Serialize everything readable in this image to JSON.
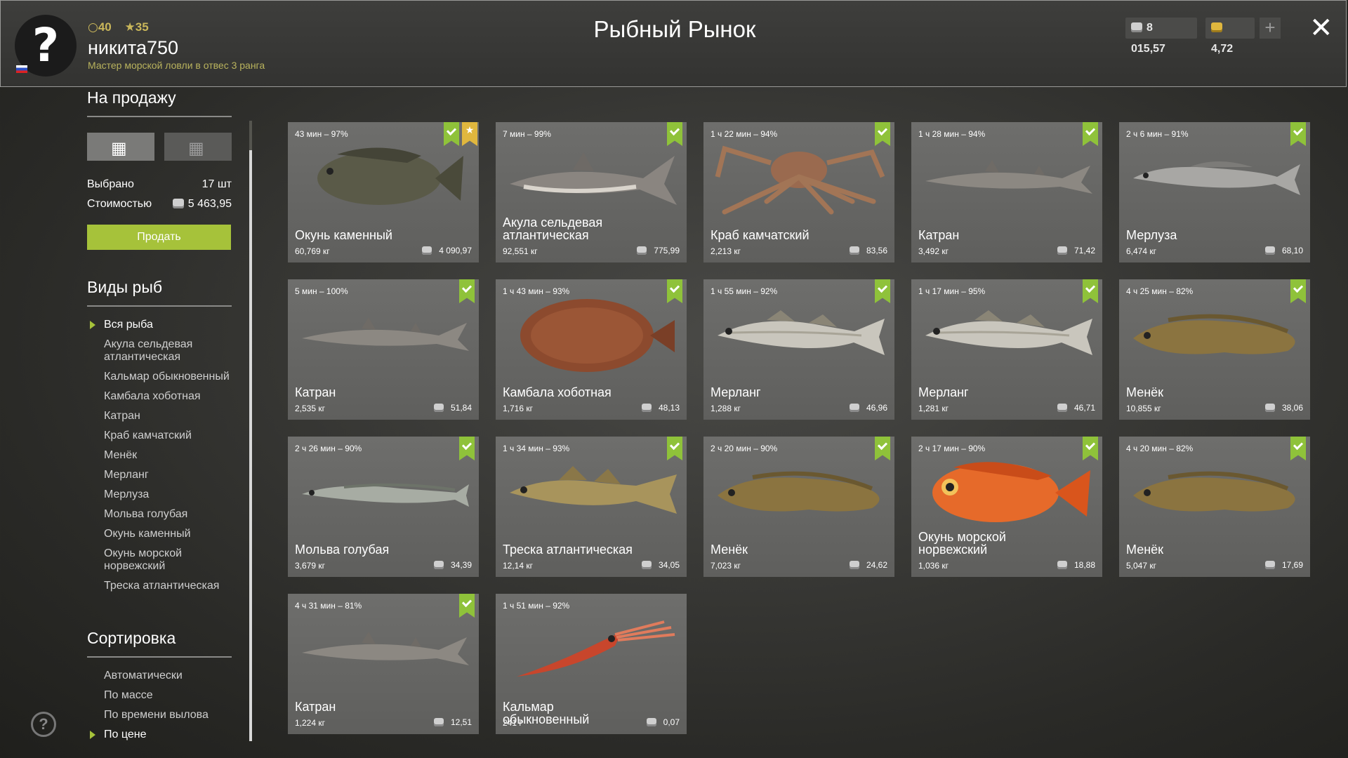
{
  "header": {
    "level": "40",
    "stars": "35",
    "username": "никита750",
    "rank": "Мастер морской ловли в отвес 3 ранга",
    "title": "Рыбный Рынок",
    "silver": "8 015,57",
    "gold": "4,72",
    "plus": "+",
    "close": "✕",
    "avatar": "?"
  },
  "sidebar": {
    "for_sale_title": "На продажу",
    "selected_label": "Выбрано",
    "selected_value": "17 шт",
    "cost_label": "Стоимостью",
    "cost_value": "5 463,95",
    "sell_button": "Продать",
    "fish_types_title": "Виды рыб",
    "fish_types": [
      "Вся рыба",
      "Акула сельдевая атлантическая",
      "Кальмар обыкновенный",
      "Камбала хоботная",
      "Катран",
      "Краб камчатский",
      "Менёк",
      "Мерланг",
      "Мерлуза",
      "Мольва голубая",
      "Окунь каменный",
      "Окунь морской норвежский",
      "Треска атлантическая"
    ],
    "sort_title": "Сортировка",
    "sort_options": [
      "Автоматически",
      "По массе",
      "По времени вылова",
      "По цене"
    ]
  },
  "colors": {
    "accent": "#a6c23a",
    "badge": "#8fc23a",
    "gold": "#e0b73e"
  },
  "cards": [
    {
      "time": "43 мин – 97%",
      "name": "Окунь каменный",
      "weight": "60,769 кг",
      "price": "4 090,97",
      "icon": "grouper"
    },
    {
      "time": "7 мин – 99%",
      "name": "Акула сельдевая атлантическая",
      "weight": "92,551 кг",
      "price": "775,99",
      "icon": "shark"
    },
    {
      "time": "1 ч 22 мин – 94%",
      "name": "Краб камчатский",
      "weight": "2,213 кг",
      "price": "83,56",
      "icon": "crab"
    },
    {
      "time": "1 ч 28 мин – 94%",
      "name": "Катран",
      "weight": "3,492 кг",
      "price": "71,42",
      "icon": "dogfish"
    },
    {
      "time": "2 ч 6 мин – 91%",
      "name": "Мерлуза",
      "weight": "6,474 кг",
      "price": "68,10",
      "icon": "hake"
    },
    {
      "time": "5 мин – 100%",
      "name": "Катран",
      "weight": "2,535 кг",
      "price": "51,84",
      "icon": "dogfish"
    },
    {
      "time": "1 ч 43 мин – 93%",
      "name": "Камбала хоботная",
      "weight": "1,716 кг",
      "price": "48,13",
      "icon": "flounder"
    },
    {
      "time": "1 ч 55 мин – 92%",
      "name": "Мерланг",
      "weight": "1,288 кг",
      "price": "46,96",
      "icon": "whiting"
    },
    {
      "time": "1 ч 17 мин – 95%",
      "name": "Мерланг",
      "weight": "1,281 кг",
      "price": "46,71",
      "icon": "whiting"
    },
    {
      "time": "4 ч 25 мин – 82%",
      "name": "Менёк",
      "weight": "10,855 кг",
      "price": "38,06",
      "icon": "tusk"
    },
    {
      "time": "2 ч 26 мин – 90%",
      "name": "Мольва голубая",
      "weight": "3,679 кг",
      "price": "34,39",
      "icon": "ling"
    },
    {
      "time": "1 ч 34 мин – 93%",
      "name": "Треска атлантическая",
      "weight": "12,14 кг",
      "price": "34,05",
      "icon": "cod"
    },
    {
      "time": "2 ч 20 мин – 90%",
      "name": "Менёк",
      "weight": "7,023 кг",
      "price": "24,62",
      "icon": "tusk"
    },
    {
      "time": "2 ч 17 мин – 90%",
      "name": "Окунь морской норвежский",
      "weight": "1,036 кг",
      "price": "18,88",
      "icon": "redfish"
    },
    {
      "time": "4 ч 20 мин – 82%",
      "name": "Менёк",
      "weight": "5,047 кг",
      "price": "17,69",
      "icon": "tusk"
    },
    {
      "time": "4 ч 31 мин – 81%",
      "name": "Катран",
      "weight": "1,224 кг",
      "price": "12,51",
      "icon": "dogfish"
    },
    {
      "time": "1 ч 51 мин – 92%",
      "name": "Кальмар обыкновенный",
      "weight": "241 г",
      "price": "0,07",
      "icon": "squid"
    }
  ]
}
